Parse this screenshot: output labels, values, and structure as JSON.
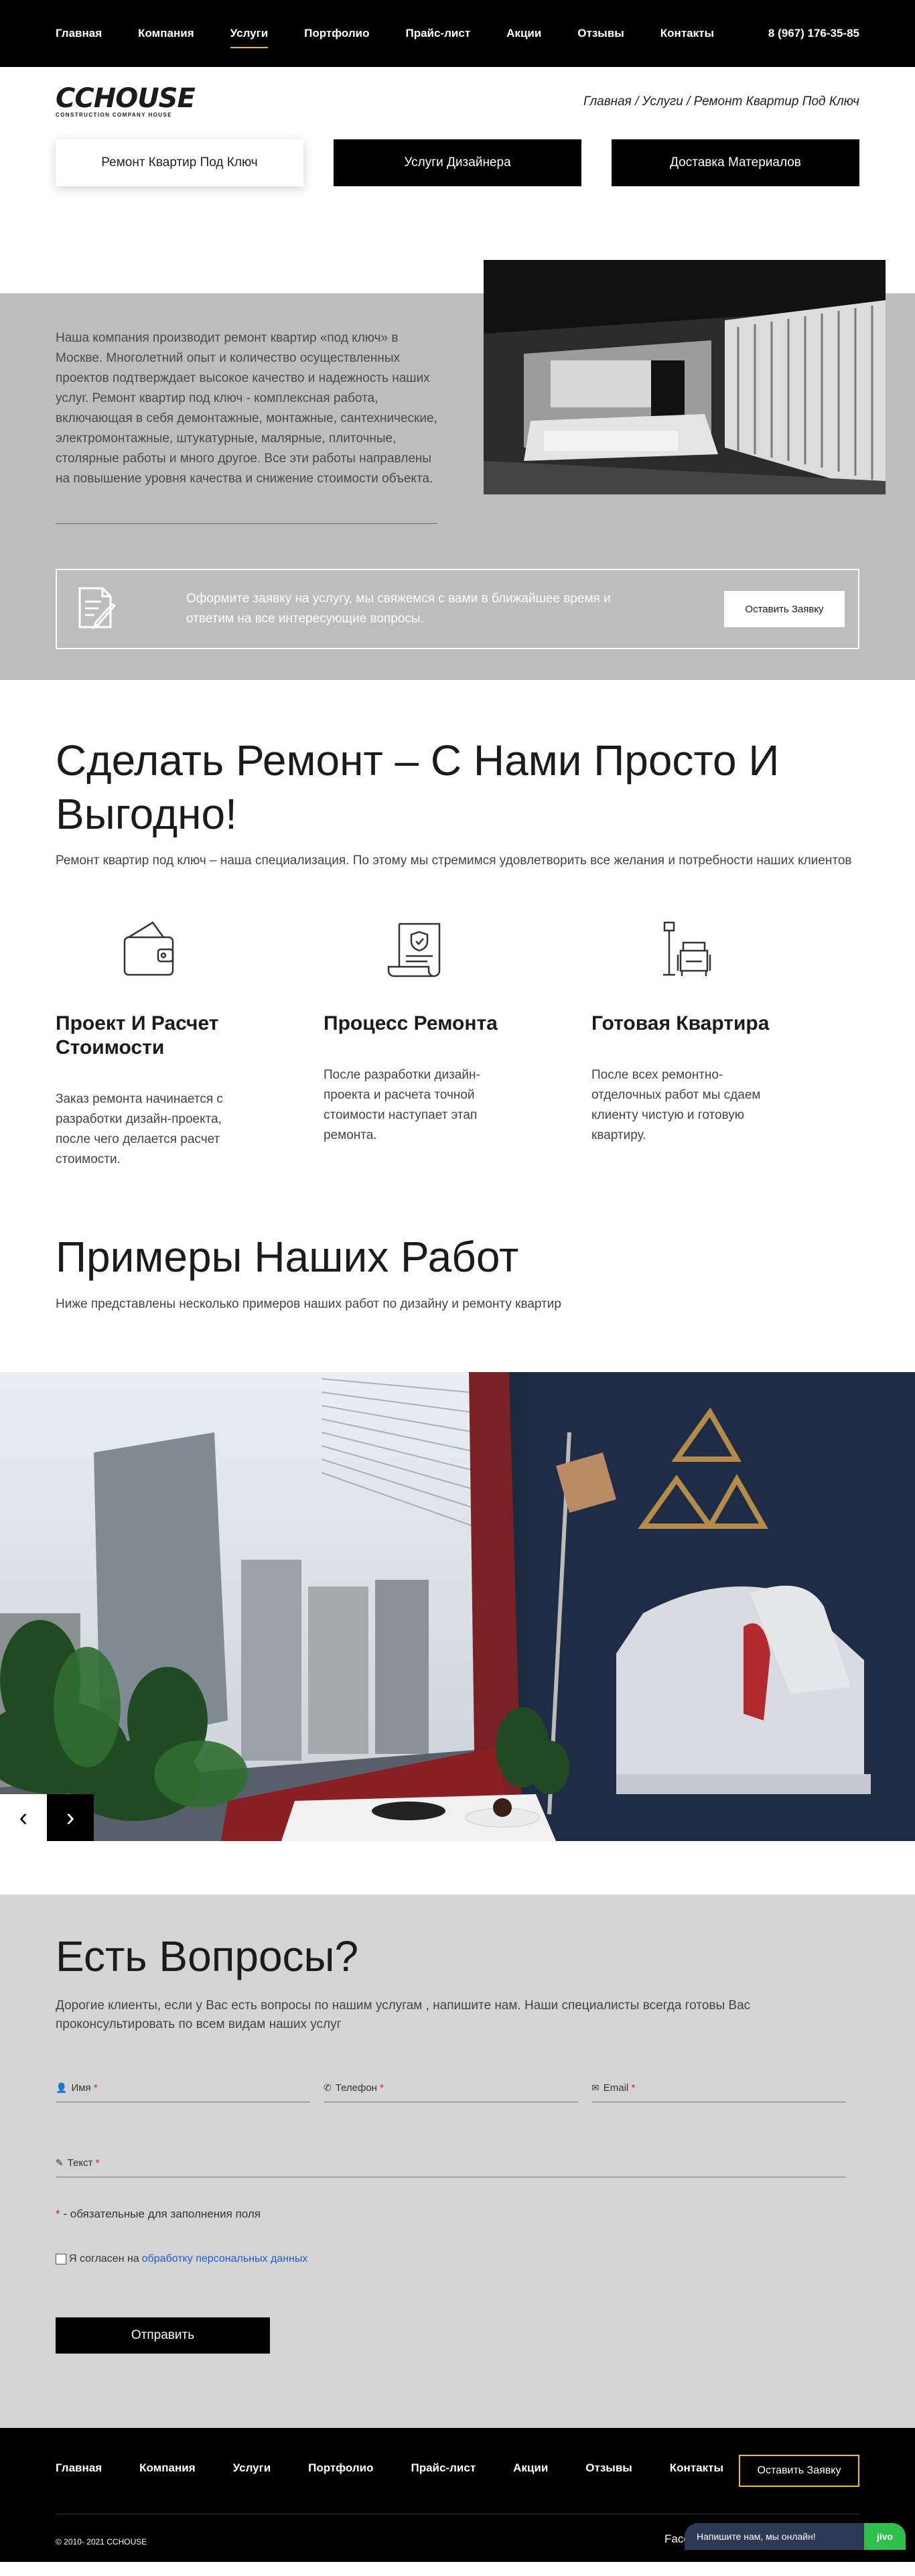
{
  "header": {
    "nav": [
      "Главная",
      "Компания",
      "Услуги",
      "Портфолио",
      "Прайс-лист",
      "Акции",
      "Отзывы",
      "Контакты"
    ],
    "active": "Услуги",
    "phone": "8 (967) 176-35-85"
  },
  "logo": {
    "main": "CCHOUSE",
    "sub": "CONSTRUCTION COMPANY HOUSE"
  },
  "breadcrumb": "Главная / Услуги / Ремонт Квартир Под Ключ",
  "service_tabs": [
    "Ремонт Квартир Под Ключ",
    "Услуги Дизайнера",
    "Доставка Материалов"
  ],
  "intro": {
    "text": "Наша компания производит ремонт квартир «под ключ» в Москве. Многолетний опыт и количество осуществленных проектов подтверждает высокое качество и надежность наших услуг. Ремонт квартир под ключ - комплексная работа, включающая в себя демонтажные, монтажные, сантехнические, электромонтажные, штукатурные, малярные, плиточные, столярные работы и много другое. Все эти работы направлены на повышение уровня качества и снижение стоимости объекта.",
    "cta_text": "Оформите заявку на услугу, мы свяжемся с вами в ближайшее время и ответим на все интересующие вопросы.",
    "cta_button": "Оставить Заявку"
  },
  "advantages": {
    "title": "Сделать Ремонт – С Нами Просто И Выгодно!",
    "lead": "Ремонт квартир под ключ – наша специализация. По этому мы стремимся удовлетворить все желания и потребности наших клиентов",
    "items": [
      {
        "title": "Проект И Расчет Стоимости",
        "text": "Заказ ремонта начинается с разработки дизайн-проекта, после чего делается расчет стоимости.",
        "icon": "wallet-icon"
      },
      {
        "title": "Процесс Ремонта",
        "text": "После разработки дизайн-проекта и расчета точной стоимости наступает этап ремонта.",
        "icon": "certificate-icon"
      },
      {
        "title": "Готовая Квартира",
        "text": "После всех ремонтно-отделочных работ мы сдаем клиенту чистую и готовую квартиру.",
        "icon": "armchair-lamp-icon"
      }
    ]
  },
  "works": {
    "title": "Примеры Наших Работ",
    "lead": "Ниже представлены несколько примеров наших работ по дизайну и ремонту квартир"
  },
  "questions": {
    "title": "Есть Вопросы?",
    "lead": "Дорогие клиенты, если у Вас есть вопросы по нашим услугам , напишите нам. Наши специалисты всегда готовы Вас проконсультировать по всем видам наших услуг",
    "name_label": "Имя",
    "phone_label": "Телефон",
    "email_label": "Email",
    "text_label": "Текст",
    "required_mark": "*",
    "note": "- обязательные для заполнения поля",
    "agree_text": "Я согласен на",
    "agree_link": "обработку персональных данных",
    "submit": "Отправить"
  },
  "footer": {
    "nav": [
      "Главная",
      "Компания",
      "Услуги",
      "Портфолио",
      "Прайс-лист",
      "Акции",
      "Отзывы",
      "Контакты"
    ],
    "button": "Оставить Заявку",
    "copyright": "© 2010- 2021 CCHOUSE",
    "fb": "Face",
    "chat_text": "Напишите нам, мы онлайн!",
    "chat_brand": "jivo"
  },
  "colors": {
    "accent": "#f2c200",
    "dark": "#000000",
    "grey": "#bdbdbd",
    "light_grey": "#d4d4d4"
  }
}
